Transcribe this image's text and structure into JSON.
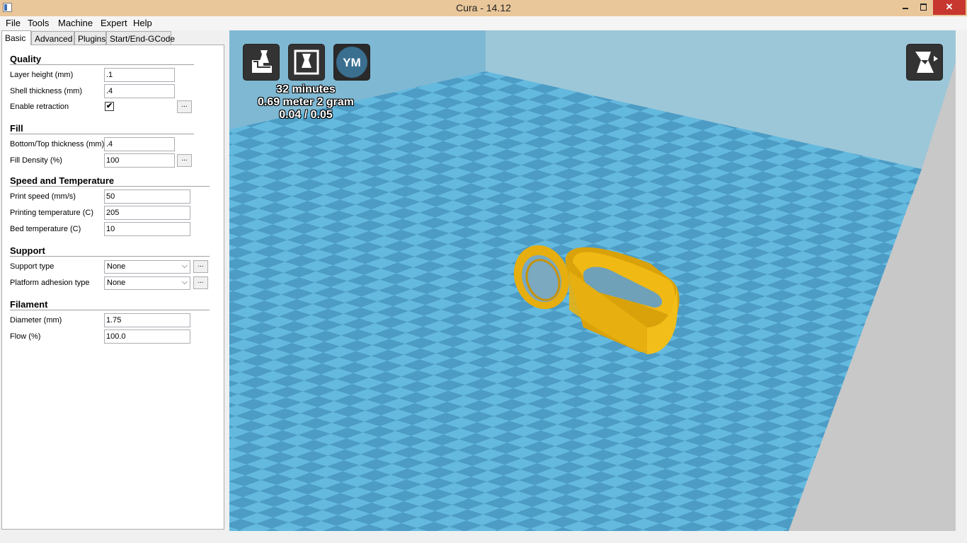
{
  "window": {
    "title": "Cura - 14.12",
    "close_glyph": "✕"
  },
  "menu": [
    "File",
    "Tools",
    "Machine",
    "Expert",
    "Help"
  ],
  "tabs": [
    "Basic",
    "Advanced",
    "Plugins",
    "Start/End-GCode"
  ],
  "sections": {
    "quality": "Quality",
    "fill": "Fill",
    "speed": "Speed and Temperature",
    "support": "Support",
    "filament": "Filament"
  },
  "fields": {
    "layer_height": {
      "label": "Layer height (mm)",
      "value": ".1"
    },
    "shell_thickness": {
      "label": "Shell thickness (mm)",
      "value": ".4"
    },
    "enable_retraction": {
      "label": "Enable retraction",
      "checked": "✔"
    },
    "bottom_top": {
      "label": "Bottom/Top thickness (mm)",
      "value": ".4"
    },
    "fill_density": {
      "label": "Fill Density (%)",
      "value": "100"
    },
    "print_speed": {
      "label": "Print speed (mm/s)",
      "value": "50"
    },
    "print_temp": {
      "label": "Printing temperature (C)",
      "value": "205"
    },
    "bed_temp": {
      "label": "Bed temperature (C)",
      "value": "10"
    },
    "support_type": {
      "label": "Support type",
      "value": "None"
    },
    "adhesion": {
      "label": "Platform adhesion type",
      "value": "None"
    },
    "diameter": {
      "label": "Diameter (mm)",
      "value": "1.75"
    },
    "flow": {
      "label": "Flow (%)",
      "value": "100.0"
    }
  },
  "more_button": "...",
  "viewport": {
    "ym_label": "YM",
    "print_time": "32 minutes",
    "material": "0.69 meter 2 gram",
    "cost": "0.04 / 0.05",
    "colors": {
      "model": "#f2b90f",
      "sky": "#7eb8d4",
      "tile_light": "#62b6dc",
      "tile_dark": "#4a9ac2"
    }
  }
}
